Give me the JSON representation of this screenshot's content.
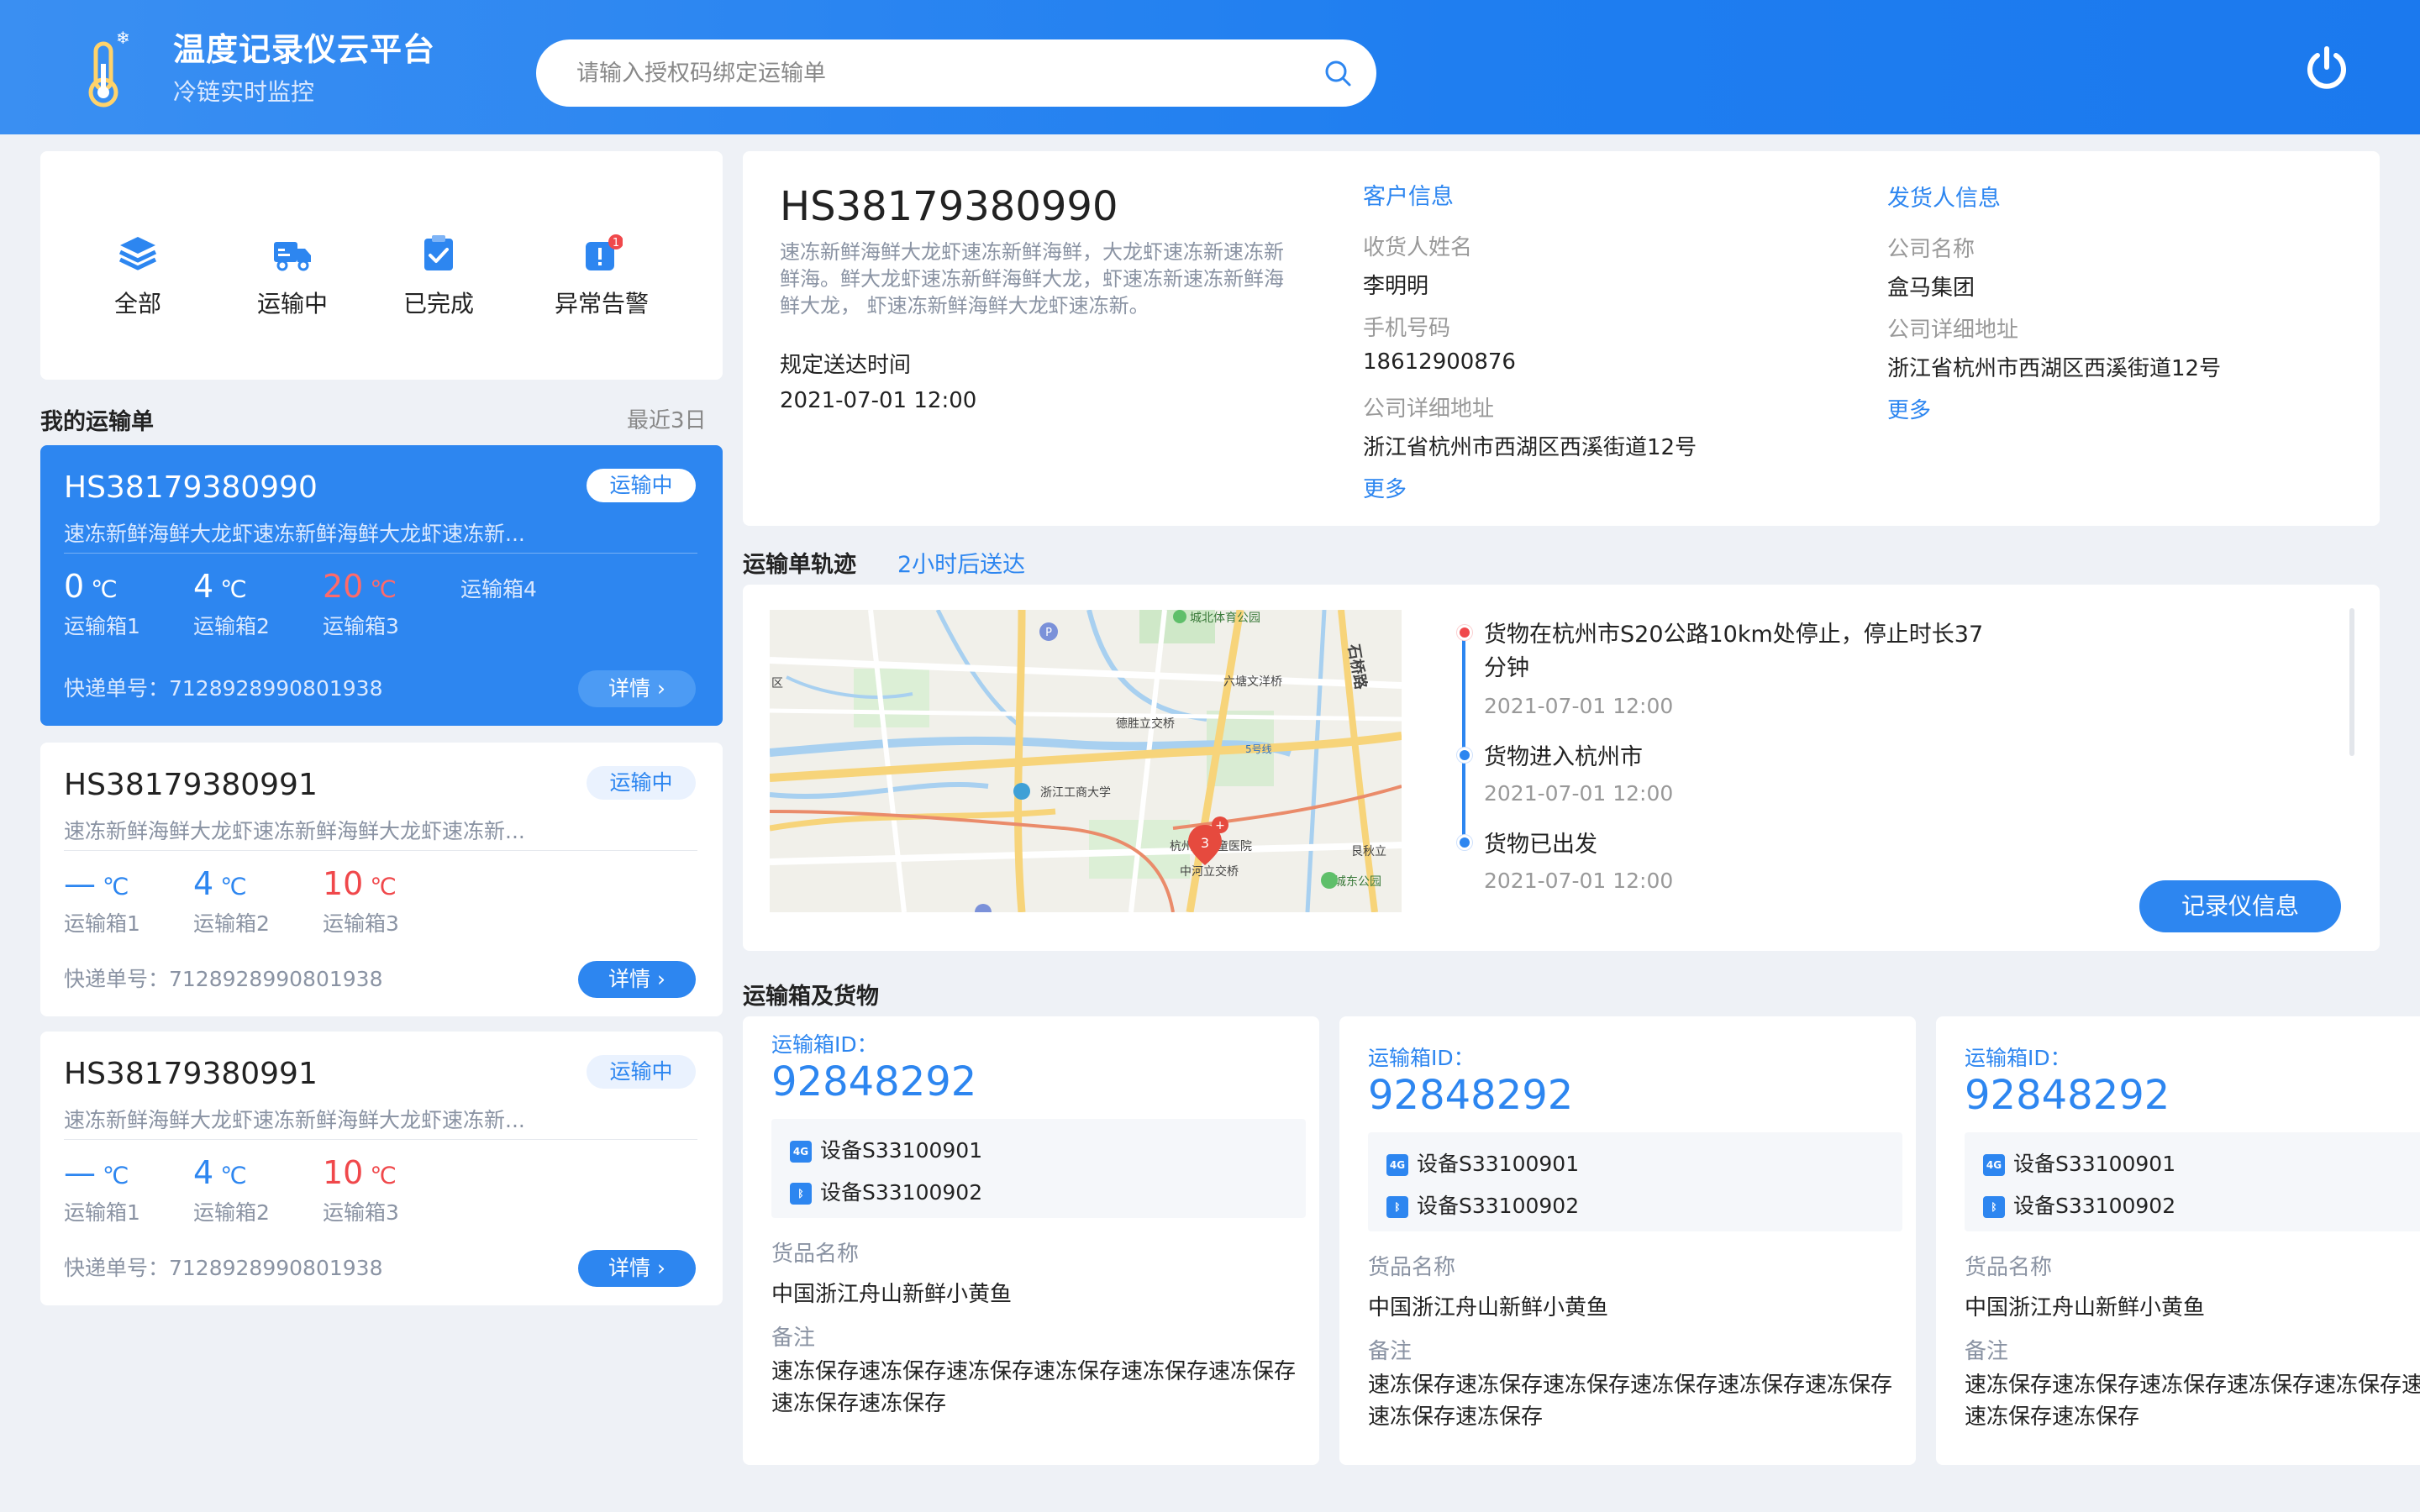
{
  "header": {
    "title": "温度记录仪云平台",
    "subtitle": "冷链实时监控",
    "search_placeholder": "请输入授权码绑定运输单"
  },
  "filters": [
    {
      "label": "全部",
      "icon": "layers-icon"
    },
    {
      "label": "运输中",
      "icon": "truck-icon"
    },
    {
      "label": "已完成",
      "icon": "clipboard-check-icon"
    },
    {
      "label": "异常告警",
      "icon": "alert-icon",
      "badge": "1"
    }
  ],
  "orders_section": {
    "title": "我的运输单",
    "range": "最近3日"
  },
  "orders": [
    {
      "id": "HS38179380990",
      "desc": "速冻新鲜海鲜大龙虾速冻新鲜海鲜大龙虾速冻新...",
      "status": "运输中",
      "temps": [
        {
          "value": "0",
          "unit": "℃",
          "label": "运输箱1"
        },
        {
          "value": "4",
          "unit": "℃",
          "label": "运输箱2"
        },
        {
          "value": "20",
          "unit": "℃",
          "label": "运输箱3"
        },
        {
          "value": "",
          "unit": "",
          "label": "运输箱4"
        }
      ],
      "tracking": "快递单号：7128928990801938",
      "detail_label": "详情"
    },
    {
      "id": "HS38179380991",
      "desc": "速冻新鲜海鲜大龙虾速冻新鲜海鲜大龙虾速冻新...",
      "status": "运输中",
      "temps": [
        {
          "value": "—",
          "unit": "℃",
          "label": "运输箱1"
        },
        {
          "value": "4",
          "unit": "℃",
          "label": "运输箱2"
        },
        {
          "value": "10",
          "unit": "℃",
          "label": "运输箱3"
        }
      ],
      "tracking": "快递单号：7128928990801938",
      "detail_label": "详情"
    },
    {
      "id": "HS38179380991",
      "desc": "速冻新鲜海鲜大龙虾速冻新鲜海鲜大龙虾速冻新...",
      "status": "运输中",
      "temps": [
        {
          "value": "—",
          "unit": "℃",
          "label": "运输箱1"
        },
        {
          "value": "4",
          "unit": "℃",
          "label": "运输箱2"
        },
        {
          "value": "10",
          "unit": "℃",
          "label": "运输箱3"
        }
      ],
      "tracking": "快递单号：7128928990801938",
      "detail_label": "详情"
    }
  ],
  "detail": {
    "id": "HS38179380990",
    "desc": "速冻新鲜海鲜大龙虾速冻新鲜海鲜，大龙虾速冻新速冻新鲜海。鲜大龙虾速冻新鲜海鲜大龙，虾速冻新速冻新鲜海鲜大龙， 虾速冻新鲜海鲜大龙虾速冻新。",
    "deadline_label": "规定送达时间",
    "deadline": "2021-07-01 12:00",
    "customer": {
      "title": "客户信息",
      "name_label": "收货人姓名",
      "name": "李明明",
      "phone_label": "手机号码",
      "phone": "18612900876",
      "address_label": "公司详细地址",
      "address": "浙江省杭州市西湖区西溪街道12号",
      "more": "更多"
    },
    "sender": {
      "title": "发货人信息",
      "company_label": "公司名称",
      "company": "盒马集团",
      "address_label": "公司详细地址",
      "address": "浙江省杭州市西湖区西溪街道12号",
      "more": "更多"
    }
  },
  "track": {
    "title": "运输单轨迹",
    "eta": "2小时后送达",
    "map_labels": {
      "park": "城北体育公园",
      "interchange1": "六塘文洋桥",
      "interchange2": "德胜立交桥",
      "university": "浙江工商大学",
      "hospital": "杭州市儿童医院",
      "bridge": "中河立交桥",
      "east_park": "城东公园",
      "road": "石桥路",
      "metro": "5号线",
      "district": "区",
      "gen": "艮秋立",
      "marker": "3"
    },
    "events": [
      {
        "text": "货物在杭州市S20公路10km处停止，停止时长37分钟",
        "time": "2021-07-01 12:00"
      },
      {
        "text": "货物进入杭州市",
        "time": "2021-07-01 12:00"
      },
      {
        "text": "货物已出发",
        "time": "2021-07-01 12:00"
      }
    ],
    "record_button": "记录仪信息"
  },
  "boxes_section": {
    "title": "运输箱及货物"
  },
  "boxes": [
    {
      "id_label": "运输箱ID：",
      "id": "92848292",
      "devices": [
        {
          "type": "4G",
          "name": "设备S33100901"
        },
        {
          "type": "BT",
          "name": "设备S33100902"
        }
      ],
      "goods_label": "货品名称",
      "goods": "中国浙江舟山新鲜小黄鱼",
      "note_label": "备注",
      "note": "速冻保存速冻保存速冻保存速冻保存速冻保存速冻保存速冻保存速冻保存"
    },
    {
      "id_label": "运输箱ID：",
      "id": "92848292",
      "devices": [
        {
          "type": "4G",
          "name": "设备S33100901"
        },
        {
          "type": "BT",
          "name": "设备S33100902"
        }
      ],
      "goods_label": "货品名称",
      "goods": "中国浙江舟山新鲜小黄鱼",
      "note_label": "备注",
      "note": "速冻保存速冻保存速冻保存速冻保存速冻保存速冻保存速冻保存速冻保存"
    },
    {
      "id_label": "运输箱ID：",
      "id": "92848292",
      "devices": [
        {
          "type": "4G",
          "name": "设备S33100901"
        },
        {
          "type": "BT",
          "name": "设备S33100902"
        }
      ],
      "goods_label": "货品名称",
      "goods": "中国浙江舟山新鲜小黄鱼",
      "note_label": "备注",
      "note": "速冻保存速冻保存速冻保存速冻保存速冻保存速冻保存速冻保存速冻保存"
    }
  ],
  "colors": {
    "primary": "#2d86f0",
    "alarm": "#f0484b",
    "bg": "#eef1f6"
  }
}
